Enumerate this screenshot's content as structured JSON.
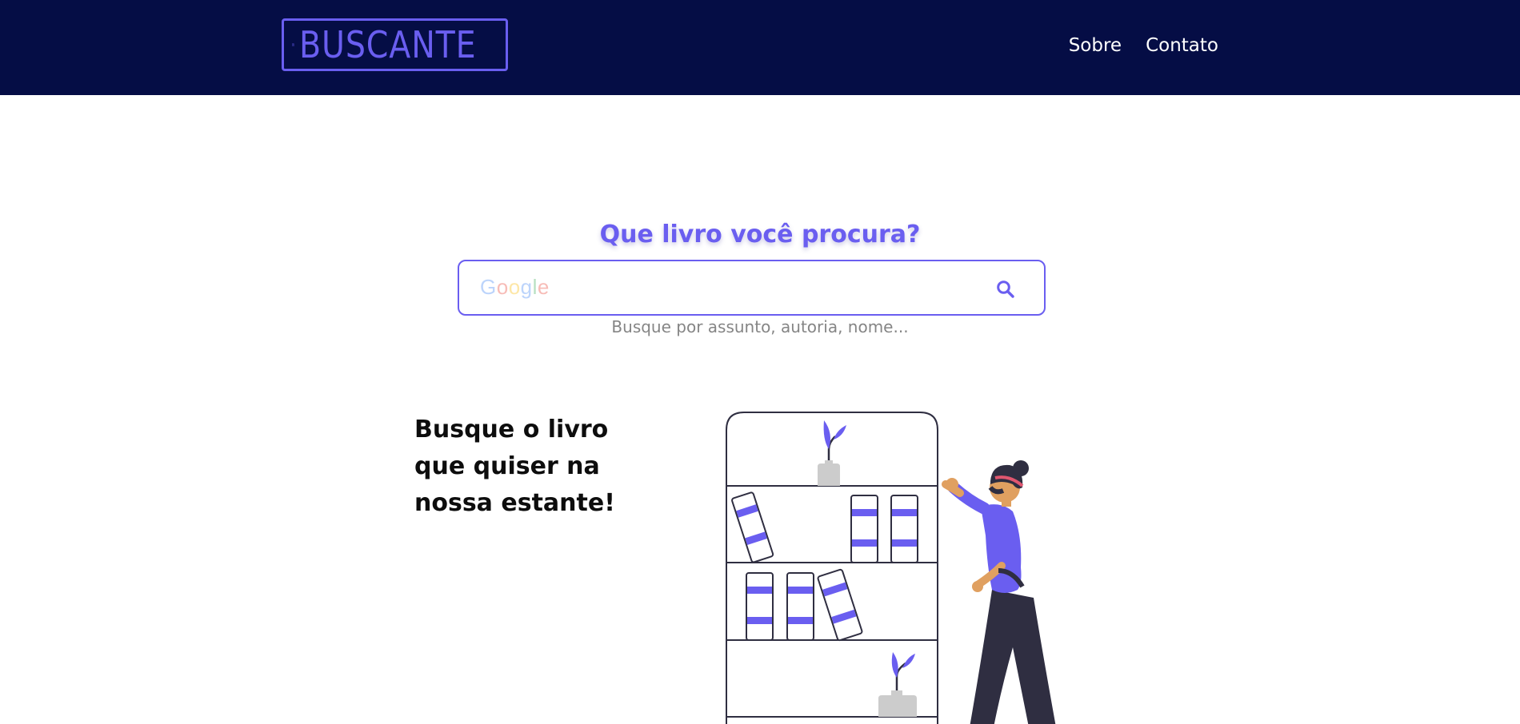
{
  "header": {
    "logo_text": "BUSCANTE",
    "nav": [
      {
        "label": "Sobre"
      },
      {
        "label": "Contato"
      }
    ]
  },
  "search": {
    "headline": "Que livro você procura?",
    "value": "",
    "placeholder_brand": "Google",
    "helper": "Busque por assunto, autoria, nome..."
  },
  "hero": {
    "tagline_lines": [
      "Busque o livro",
      "que quiser na",
      "nossa estante!"
    ]
  },
  "icons": {
    "logo": "books-icon",
    "search": "search-icon"
  },
  "colors": {
    "header_bg": "#050d45",
    "accent": "#6a5ef0",
    "text_dark": "#0d0d0d",
    "helper_text": "#858585",
    "figure_dark": "#2f2e41",
    "skin": "#e0a060",
    "headband": "#e0566f"
  }
}
